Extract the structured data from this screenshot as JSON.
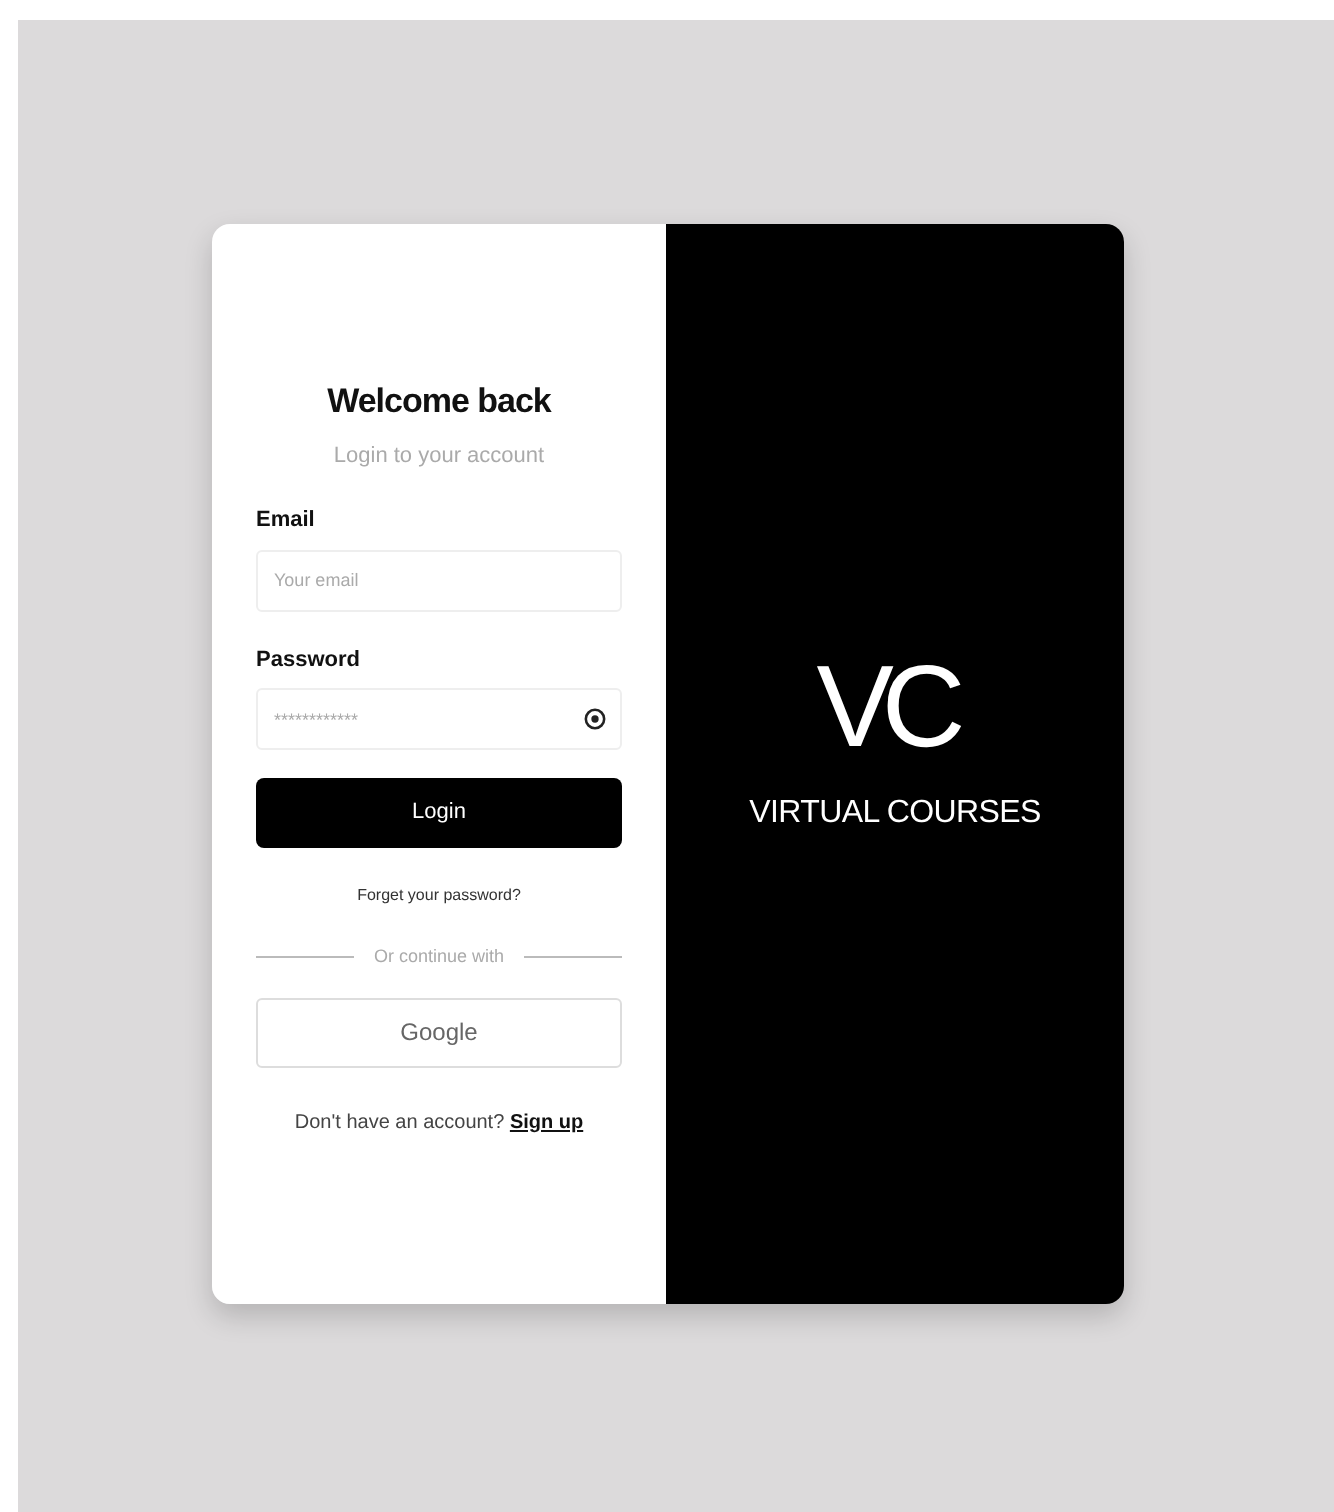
{
  "login": {
    "title": "Welcome back",
    "subtitle": "Login to your account",
    "fields": [
      {
        "label": "Email",
        "placeholder": "Your email",
        "kind": "plain"
      },
      {
        "label": "Password",
        "placeholder": "************",
        "kind": "secret"
      }
    ],
    "submit": "Login",
    "forgot": "Forget your password?",
    "divider": "Or continue with",
    "google": "Google",
    "signup_prompt": "Don't have an account?",
    "signup_link": "Sign up"
  },
  "brand": {
    "logo": "VC",
    "name": "VIRTUAL COURSES"
  }
}
